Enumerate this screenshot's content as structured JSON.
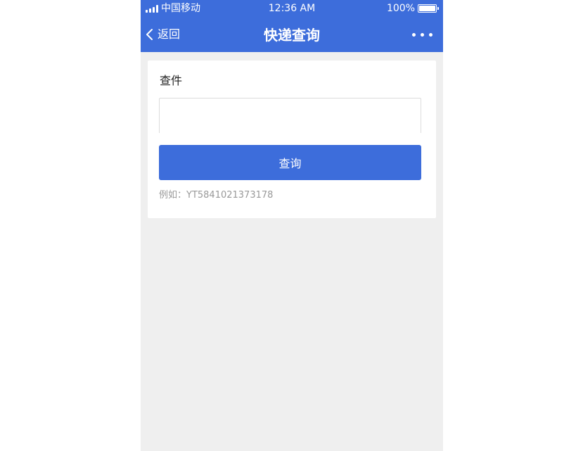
{
  "status_bar": {
    "carrier": "中国移动",
    "time": "12:36 AM",
    "battery": "100%",
    "battery_level": 1.0
  },
  "nav": {
    "back_label": "返回",
    "title": "快递查询",
    "back_icon": "chevron-left-icon",
    "more_icon": "more-horizontal-icon"
  },
  "form": {
    "label": "查件",
    "input_value": "",
    "input_placeholder": "",
    "submit_label": "查询",
    "hint": "例如：YT5841021373178"
  },
  "colors": {
    "brand": "#3d6ddb",
    "page_background": "#efefef",
    "hint_text": "#999999"
  }
}
